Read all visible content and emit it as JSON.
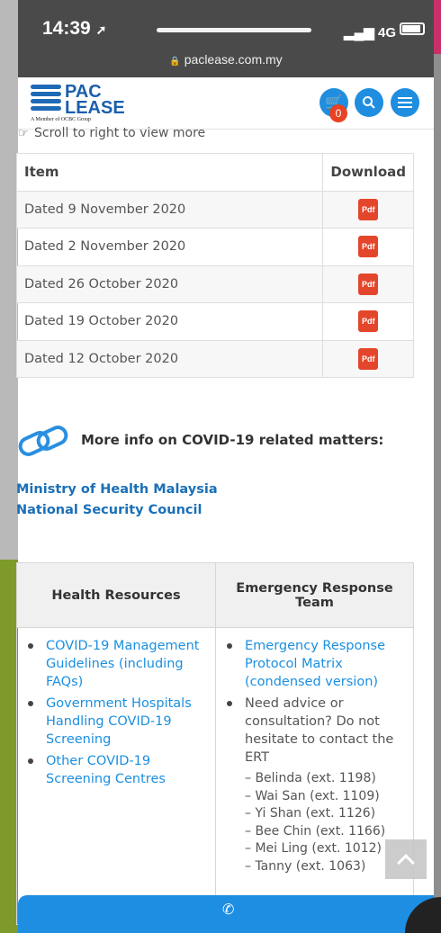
{
  "status": {
    "time": "14:39",
    "network": "4G"
  },
  "browser": {
    "url": "paclease.com.my"
  },
  "header": {
    "brand_line1": "PAC",
    "brand_line2": "LEASE",
    "tagline": "A Member of OCBC Group",
    "cart_count": "0"
  },
  "hint": "Scroll to right to view more",
  "downloads": {
    "headers": {
      "item": "Item",
      "download": "Download"
    },
    "pdf_label": "Pdf",
    "rows": [
      {
        "item": "Dated 9 November 2020"
      },
      {
        "item": "Dated 2 November 2020"
      },
      {
        "item": "Dated 26 October 2020"
      },
      {
        "item": "Dated 19 October 2020"
      },
      {
        "item": "Dated 12 October 2020"
      }
    ]
  },
  "covid": {
    "heading": "More info on COVID-19 related matters:",
    "links": [
      "Ministry of Health Malaysia",
      "National Security Council"
    ]
  },
  "resources": {
    "col1_header": "Health Resources",
    "col2_header": "Emergency Response Team",
    "health_links": [
      "COVID-19 Management Guidelines (including FAQs)",
      "Government Hospitals Handling COVID-19 Screening",
      "Other COVID-19 Screening Centres"
    ],
    "ert_link": "Emergency Response Protocol Matrix (condensed version)",
    "ert_advice": "Need advice or consultation? Do not hesitate to contact the ERT",
    "contacts": [
      "– Belinda (ext. 1198)",
      "– Wai San (ext. 1109)",
      "– Yi Shan (ext. 1126)",
      "– Bee Chin (ext. 1166)",
      "– Mei Ling (ext. 1012)",
      "– Tanny (ext. 1063)"
    ]
  },
  "colors": {
    "accent": "#1f8ee0",
    "link": "#1a6fb8",
    "pdf": "#e4462b",
    "badge": "#e64324"
  },
  "icons": [
    "location-arrow-icon",
    "signal-icon",
    "battery-icon",
    "lock-icon",
    "cart-icon",
    "search-icon",
    "menu-icon",
    "hand-point-right-icon",
    "link-icon",
    "pdf-icon",
    "chevron-up-icon",
    "phone-icon"
  ]
}
